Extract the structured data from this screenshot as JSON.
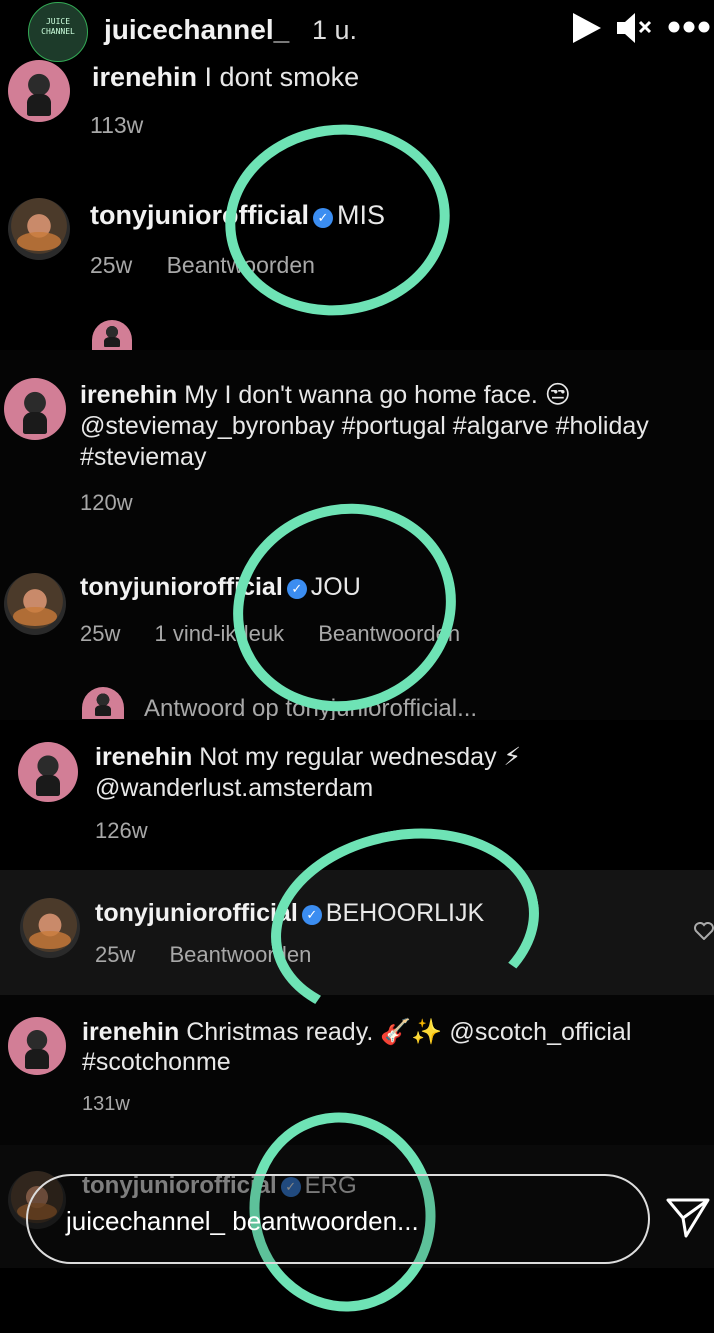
{
  "story": {
    "username": "juicechannel_",
    "time": "1 u.",
    "avatar_text": "JUICE CHANNEL"
  },
  "comments": [
    {
      "user": "irenehin",
      "text": "I dont smoke",
      "age": "113w"
    },
    {
      "user": "tonyjuniorofficial",
      "text": "MIS",
      "age": "25w",
      "reply": "Beantwoorden"
    },
    {
      "user": "irenehin",
      "text_lines": [
        "My I don't wanna go home face. 😒",
        "@steviemay_byronbay #portugal #algarve #holiday",
        "#steviemay"
      ],
      "age": "120w"
    },
    {
      "user": "tonyjuniorofficial",
      "text": "JOU",
      "age": "25w",
      "likes": "1 vind-ik-leuk",
      "reply": "Beantwoorden"
    },
    {
      "reply_to": "Antwoord op tonyjuniorofficial..."
    },
    {
      "user": "irenehin",
      "text_lines": [
        "Not my regular wednesday ⚡",
        "@wanderlust.amsterdam"
      ],
      "age": "126w"
    },
    {
      "user": "tonyjuniorofficial",
      "text": "BEHOORLIJK",
      "age": "25w",
      "reply": "Beantwoorden"
    },
    {
      "user": "irenehin",
      "text_lines": [
        "Christmas ready. 🎸✨ @scotch_official",
        "#scotchonme"
      ],
      "age": "131w"
    },
    {
      "user": "tonyjuniorofficial",
      "text": "ERG"
    }
  ],
  "reply_field": {
    "placeholder": "juicechannel_ beantwoorden..."
  },
  "colors": {
    "highlight": "#6ee3b5",
    "verified": "#3b8df1",
    "background": "#000000"
  }
}
